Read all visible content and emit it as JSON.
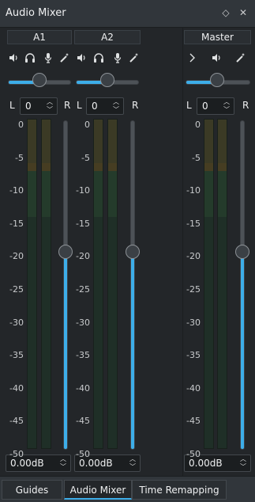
{
  "window": {
    "title": "Audio Mixer",
    "float_icon": "diamond-icon",
    "close_icon": "close-icon"
  },
  "scale_labels": [
    "0",
    "-5",
    "-10",
    "-15",
    "-20",
    "-25",
    "-30",
    "-35",
    "-40",
    "-45",
    "-50"
  ],
  "channels": [
    {
      "name": "A1",
      "icons": [
        "speaker-icon",
        "headphones-icon",
        "microphone-icon",
        "magic-wand-icon"
      ],
      "pan_left_label": "L",
      "pan_value": "0",
      "pan_right_label": "R",
      "gain": "0.00dB",
      "volume_fraction": 0.5,
      "fader_level_fraction": 0.6
    },
    {
      "name": "A2",
      "icons": [
        "speaker-icon",
        "headphones-icon",
        "microphone-icon",
        "magic-wand-icon"
      ],
      "pan_left_label": "L",
      "pan_value": "0",
      "pan_right_label": "R",
      "gain": "0.00dB",
      "volume_fraction": 0.5,
      "fader_level_fraction": 0.6
    },
    {
      "name": "Master",
      "icons": [
        "chevron-right-icon",
        "speaker-icon",
        "magic-wand-icon"
      ],
      "pan_left_label": "L",
      "pan_value": "0",
      "pan_right_label": "R",
      "gain": "0.00dB",
      "volume_fraction": 0.5,
      "fader_level_fraction": 0.6
    }
  ],
  "tabs": [
    {
      "label": "Guides",
      "active": false
    },
    {
      "label": "Audio Mixer",
      "active": true
    },
    {
      "label": "Time Remapping",
      "active": false
    }
  ],
  "colors": {
    "accent": "#3daee9",
    "background": "#232629",
    "chrome": "#31363b"
  }
}
